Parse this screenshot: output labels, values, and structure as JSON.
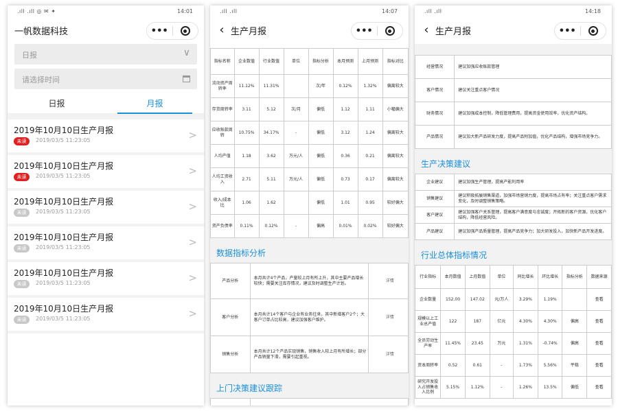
{
  "phone1": {
    "status_time": "14:01",
    "title": "一帆数据科技",
    "date_type_placeholder": "日报",
    "date_placeholder": "请选择时间",
    "tabs": [
      "日报",
      "月报"
    ],
    "reports": [
      {
        "title": "2019年10月10日生产月报",
        "badge": "未读",
        "badge_color": "#e02020",
        "time": "2019/03/5 11:23:05"
      },
      {
        "title": "2019年10月10日生产月报",
        "badge": "未读",
        "badge_color": "#e02020",
        "time": "2019/03/5 11:23:05"
      },
      {
        "title": "2019年10月10日生产月报",
        "badge": "未读",
        "badge_color": "#c8c8c8",
        "time": "2019/03/5 11:23:05"
      },
      {
        "title": "2019年10月10日生产月报",
        "badge": "未读",
        "badge_color": "#c8c8c8",
        "time": "2019/03/5 11:23:05"
      },
      {
        "title": "2019年10月10日生产月报",
        "badge": "未读",
        "badge_color": "#c8c8c8",
        "time": "2019/03/5 11:23:05"
      },
      {
        "title": "2019年10月10日生产月报",
        "badge": "未读",
        "badge_color": "#c8c8c8",
        "time": "2019/03/5 11:23:05"
      }
    ]
  },
  "phone2": {
    "status_time": "14:07",
    "title": "生产月报",
    "main_table": {
      "headers": [
        "指标名称",
        "企业数值",
        "行业数值",
        "单位",
        "指标分析",
        "本月预测",
        "上月预测",
        "指标对比"
      ],
      "rows": [
        [
          "流动资产周转率",
          "11.12%",
          "11.31%",
          "",
          "次/年",
          "0.12%",
          "1.32%",
          "偏离较大"
        ],
        [
          "存货周转率",
          "3.11",
          "5.12",
          "次/月",
          "偏低",
          "1.12",
          "1.11",
          "小幅偏大"
        ],
        [
          "应收账款周转",
          "10.75%",
          "34.17%",
          "-",
          "偏低",
          "3.12",
          "1.24",
          "偏离较大"
        ],
        [
          "人均产值",
          "1.18",
          "3.62",
          "万元/人",
          "偏低",
          "0.36",
          "0.21",
          "偏离较大"
        ],
        [
          "人均工资收入",
          "2.71",
          "5.11",
          "万元/人",
          "偏低",
          "0.73",
          "0.17",
          "偏离较大"
        ],
        [
          "收入/成本比",
          "1.06",
          "1.62",
          "",
          "偏低",
          "1.01",
          "0.95",
          "较好偏大"
        ],
        [
          "资产负债率",
          "0.11%",
          "0.12%",
          "-",
          "偏高",
          "0.01%",
          "0.02%",
          "较好偏大"
        ]
      ]
    },
    "analysis_title": "数据指标分析",
    "analysis_rows": [
      {
        "label": "产品分析",
        "text": "本月共计4个产品，产量较上月有所上升，其中主要产品增长较快；需要关注库存情况，建议及时调整生产计划。",
        "action": "详情"
      },
      {
        "label": "客户分析",
        "text": "本月共计14个客户与企业有业务往来，其中新增客户2个；大客户订单占比较高，建议加强客户维护。",
        "action": "详情"
      },
      {
        "label": "销售分析",
        "text": "本月共计12个产品实现销售，销售收入较上月有所增长；部分产品销量下滑，需要引起重视。",
        "action": "详情"
      }
    ],
    "decision_title": "上门决策建议跟踪",
    "decision_rows": [
      {
        "label": "经营情况",
        "text": "建议加强应收账款管理"
      }
    ]
  },
  "phone3": {
    "status_time": "14:18",
    "title": "生产月报",
    "top_rows": [
      {
        "label": "经营情况",
        "text": "建议加强应收账款管理"
      },
      {
        "label": "客户情况",
        "text": "建议关注重点客户情况"
      },
      {
        "label": "财务情况",
        "text": "建议加强成本控制，降低管理费用，提高资金使用效率，优化资产结构。"
      },
      {
        "label": "产品情况",
        "text": "建议加大新产品研发力度，提高产品附加值，优化产品结构，增强市场竞争力。"
      }
    ],
    "suggestion_title": "生产决策建议",
    "suggestion_rows": [
      {
        "label": "企业建议",
        "text": "建议加强生产管理，提高产能利用率"
      },
      {
        "label": "销售建议",
        "text": "建议积极拓展销售渠道，加强市场营销力度，提高市场占有率；关注重点客户需求变化，及时调整销售策略。"
      },
      {
        "label": "客户建议",
        "text": "建议加强客户关系管理，提高客户满意度与忠诚度；开拓新的客户资源，优化客户结构，降低经营风险。"
      },
      {
        "label": "产品建议",
        "text": "建议加强产品质量管理，提高产品竞争力；加大研发投入，加快新产品开发进度。"
      }
    ],
    "industry_title": "行业总体指标情况",
    "industry_table": {
      "headers": [
        "行业指标",
        "本月数值",
        "上月数值",
        "单位",
        "同比增长",
        "环比增长",
        "指标分析",
        "数据来源"
      ],
      "rows": [
        [
          "企业数量",
          "152.00",
          "147.02",
          "元/万人",
          "3.29%",
          "1.19%",
          "",
          "查看"
        ],
        [
          "规模以上工业总产值",
          "122",
          "187",
          "亿元",
          "4.30%",
          "4.30%",
          "偏高",
          "查看"
        ],
        [
          "全员劳动生产率",
          "11.45%",
          "23.45",
          "万元",
          "1.31%",
          "-0.74%",
          "偏高",
          "查看"
        ],
        [
          "资本周转率",
          "0.52",
          "0.61",
          "-",
          "1.73%",
          "5.56%",
          "平稳",
          "查看"
        ],
        [
          "研究开发投入占销售收入比例",
          "5.15%",
          "1.12%",
          "-",
          "1.26%",
          "13.5%",
          "偏低",
          "查看"
        ]
      ]
    }
  }
}
